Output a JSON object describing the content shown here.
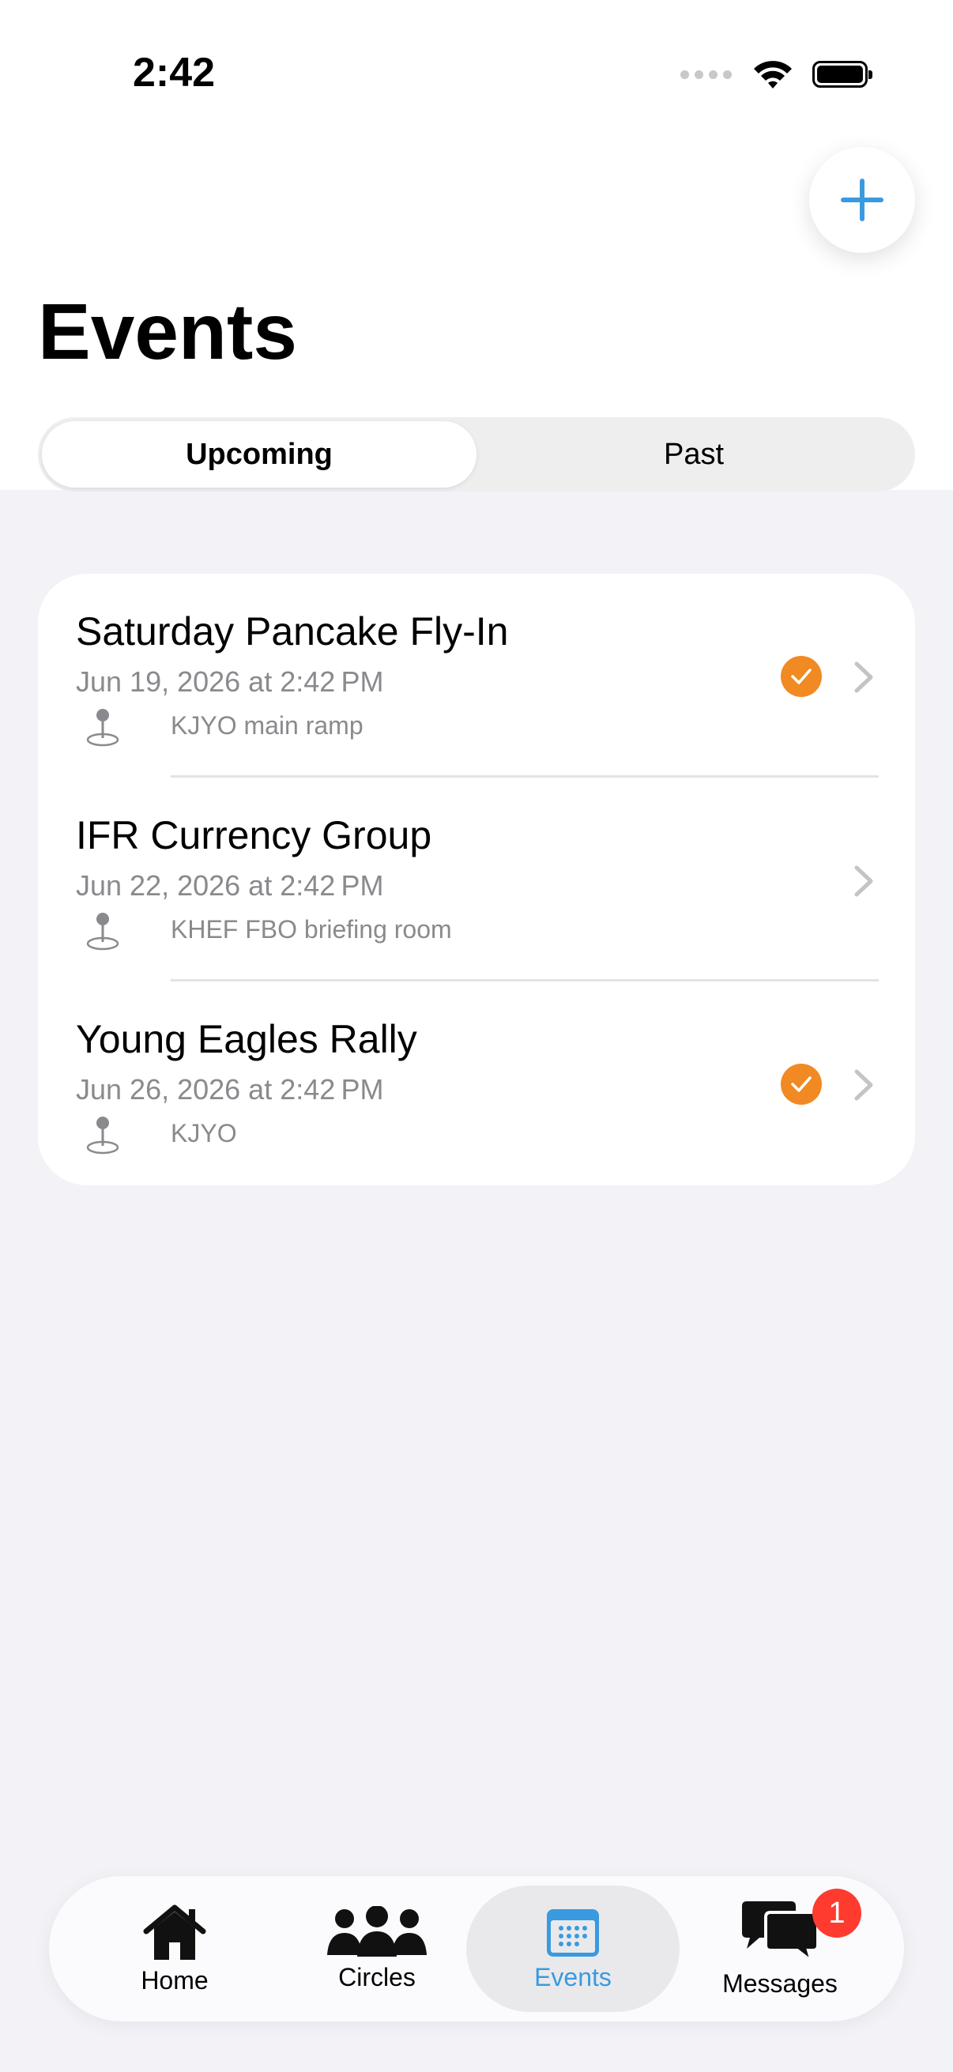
{
  "status_bar": {
    "time": "2:42"
  },
  "header": {
    "title": "Events"
  },
  "segments": [
    {
      "label": "Upcoming",
      "active": true
    },
    {
      "label": "Past",
      "active": false
    }
  ],
  "events": [
    {
      "title": "Saturday Pancake Fly-In",
      "date": "Jun 19, 2026 at 2:42 PM",
      "location": "KJYO main ramp",
      "rsvp": true
    },
    {
      "title": "IFR Currency Group",
      "date": "Jun 22, 2026 at 2:42 PM",
      "location": "KHEF FBO briefing room",
      "rsvp": false
    },
    {
      "title": "Young Eagles Rally",
      "date": "Jun 26, 2026 at 2:42 PM",
      "location": "KJYO",
      "rsvp": true
    }
  ],
  "tabs": [
    {
      "label": "Home",
      "icon": "house-icon",
      "active": false
    },
    {
      "label": "Circles",
      "icon": "people-icon",
      "active": false
    },
    {
      "label": "Events",
      "icon": "calendar-icon",
      "active": true
    },
    {
      "label": "Messages",
      "icon": "chat-bubbles-icon",
      "active": false
    }
  ],
  "messages_badge": "1",
  "colors": {
    "accent": "#3a9ae0",
    "rsvp": "#f18a22",
    "badge": "#ff3b30",
    "background": "#f2f2f7"
  }
}
